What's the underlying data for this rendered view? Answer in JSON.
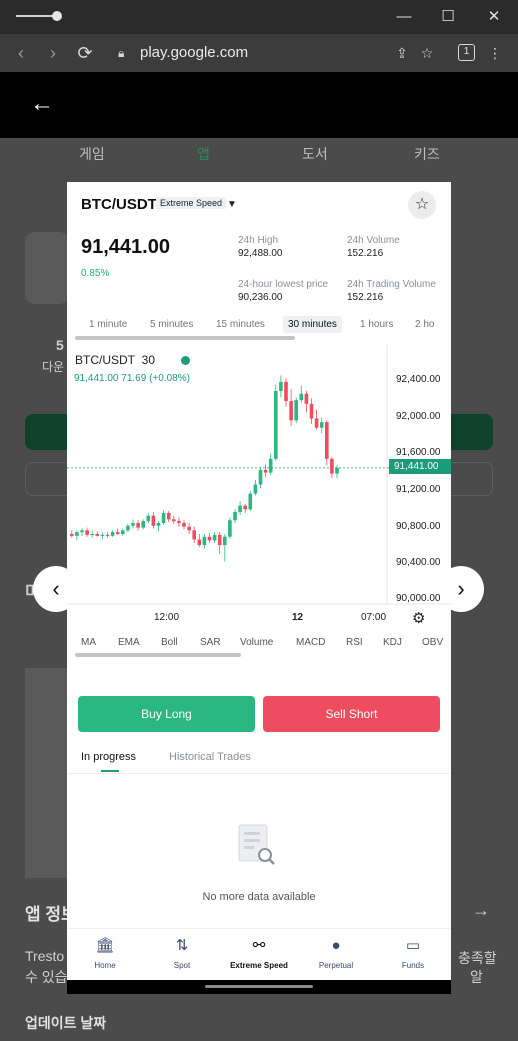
{
  "browser": {
    "url": "play.google.com",
    "tab_count": "1",
    "icons": {
      "back": "back-arrow-icon",
      "forward": "forward-arrow-icon",
      "reload": "reload-icon",
      "lock": "lock-icon",
      "share": "share-icon",
      "bookmark": "bookmark-icon",
      "menu": "more-vertical-icon"
    }
  },
  "page": {
    "tabs": [
      "게임",
      "앱",
      "도서",
      "키즈"
    ],
    "active_tab": "앱",
    "bg_number_fragment": "5",
    "bg_download_fragment": "다운",
    "bg_section_fragment": "미",
    "app_info_heading": "앱 정보",
    "app_info_text_left": "Tresto",
    "app_info_text_left2": "수 있습",
    "app_info_text_right": "충족할",
    "app_info_text_right2": "알",
    "update_date_label": "업데이트 날짜"
  },
  "screenshot": {
    "pair": "BTC/USDT",
    "speed_badge": "Extreme Speed",
    "price": "91,441.00",
    "change_pct": "0.85%",
    "stats": {
      "high_label": "24h High",
      "high_value": "92,488.00",
      "volume_label": "24h Volume",
      "volume_value": "152.216",
      "low_label": "24-hour lowest price",
      "low_value": "90,236.00",
      "trading_volume_label": "24h Trading Volume",
      "trading_volume_value": "152.216"
    },
    "intervals": [
      "1 minute",
      "5 minutes",
      "15 minutes",
      "30 minutes",
      "1 hours",
      "2 ho"
    ],
    "active_interval": "30 minutes",
    "chart": {
      "legend_pair": "BTC/USDT",
      "legend_interval": "30",
      "legend_quote": "91,441.00  71.69 (+0.08%)",
      "y_ticks": [
        "92,400.00",
        "92,000.00",
        "91,600.00",
        "91,200.00",
        "90,800.00",
        "90,400.00",
        "90,000.00"
      ],
      "current_price_tag": "91,441.00",
      "x_ticks": [
        "12:00",
        "12",
        "07:00"
      ]
    },
    "indicators": [
      "MA",
      "EMA",
      "Boll",
      "SAR",
      "Volume",
      "MACD",
      "RSI",
      "KDJ",
      "OBV"
    ],
    "buy_label": "Buy Long",
    "sell_label": "Sell Short",
    "trade_tabs": [
      "In progress",
      "Historical Trades"
    ],
    "empty_text": "No more data available",
    "bottom_nav": [
      {
        "label": "Home",
        "icon": "home-icon"
      },
      {
        "label": "Spot",
        "icon": "swap-icon"
      },
      {
        "label": "Extreme Speed",
        "icon": "speed-icon"
      },
      {
        "label": "Perpetual",
        "icon": "perpetual-icon"
      },
      {
        "label": "Funds",
        "icon": "wallet-icon"
      }
    ],
    "active_nav": "Extreme Speed",
    "colors": {
      "up": "#2bb780",
      "down": "#ee4d5f",
      "accent": "#1d9c7a"
    }
  },
  "chart_data": {
    "type": "candlestick",
    "pair": "BTC/USDT",
    "interval": "30",
    "ylim": [
      90000,
      92500
    ],
    "y_ticks": [
      92400,
      92000,
      91600,
      91200,
      90800,
      90400,
      90000
    ],
    "x_ticks": [
      "12:00",
      "12",
      "07:00"
    ],
    "last_price": 91441.0,
    "candles": [
      [
        90720,
        90760,
        90680,
        90700
      ],
      [
        90700,
        90760,
        90650,
        90740
      ],
      [
        90740,
        90780,
        90700,
        90760
      ],
      [
        90760,
        90790,
        90690,
        90710
      ],
      [
        90710,
        90760,
        90680,
        90720
      ],
      [
        90720,
        90750,
        90690,
        90700
      ],
      [
        90700,
        90740,
        90660,
        90710
      ],
      [
        90710,
        90740,
        90680,
        90700
      ],
      [
        90700,
        90760,
        90690,
        90740
      ],
      [
        90740,
        90780,
        90710,
        90720
      ],
      [
        90720,
        90780,
        90700,
        90760
      ],
      [
        90760,
        90830,
        90740,
        90810
      ],
      [
        90810,
        90880,
        90780,
        90840
      ],
      [
        90840,
        90870,
        90760,
        90790
      ],
      [
        90790,
        90880,
        90770,
        90860
      ],
      [
        90860,
        90950,
        90840,
        90920
      ],
      [
        90920,
        90960,
        90780,
        90810
      ],
      [
        90810,
        90860,
        90750,
        90840
      ],
      [
        90840,
        90980,
        90820,
        90950
      ],
      [
        90950,
        90970,
        90850,
        90880
      ],
      [
        90880,
        90920,
        90830,
        90860
      ],
      [
        90860,
        90900,
        90800,
        90840
      ],
      [
        90840,
        90870,
        90770,
        90800
      ],
      [
        90800,
        90840,
        90720,
        90760
      ],
      [
        90760,
        90800,
        90620,
        90660
      ],
      [
        90660,
        90720,
        90580,
        90600
      ],
      [
        90600,
        90720,
        90560,
        90690
      ],
      [
        90690,
        90730,
        90620,
        90650
      ],
      [
        90650,
        90740,
        90620,
        90710
      ],
      [
        90710,
        90740,
        90500,
        90600
      ],
      [
        90600,
        90720,
        90420,
        90690
      ],
      [
        90690,
        90900,
        90670,
        90870
      ],
      [
        90870,
        90990,
        90840,
        90960
      ],
      [
        90960,
        91080,
        90930,
        91030
      ],
      [
        91030,
        91050,
        90950,
        90990
      ],
      [
        90990,
        91190,
        90970,
        91160
      ],
      [
        91160,
        91310,
        91140,
        91260
      ],
      [
        91260,
        91450,
        91220,
        91420
      ],
      [
        91420,
        91480,
        91340,
        91390
      ],
      [
        91390,
        91600,
        91360,
        91540
      ],
      [
        91540,
        92350,
        91520,
        92280
      ],
      [
        92280,
        92450,
        92210,
        92380
      ],
      [
        92380,
        92420,
        92110,
        92170
      ],
      [
        92170,
        92300,
        91900,
        91960
      ],
      [
        91960,
        92210,
        91930,
        92180
      ],
      [
        92180,
        92340,
        92150,
        92250
      ],
      [
        92250,
        92280,
        92050,
        92140
      ],
      [
        92140,
        92200,
        91920,
        91980
      ],
      [
        91980,
        92080,
        91860,
        91880
      ],
      [
        91880,
        91990,
        91820,
        91940
      ],
      [
        91940,
        91960,
        91470,
        91540
      ],
      [
        91540,
        91560,
        91330,
        91380
      ],
      [
        91380,
        91470,
        91330,
        91441
      ]
    ]
  }
}
